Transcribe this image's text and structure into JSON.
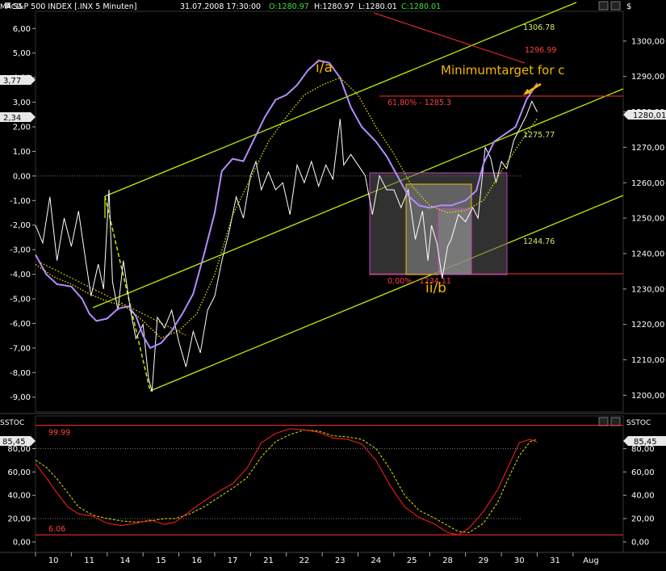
{
  "header": {
    "symbol": "S&P 500 INDEX [.INX  5 Minuten]",
    "datetime": "31.07.2008 17:30:00",
    "open": "O:1280.97",
    "high": "H:1280.97",
    "low": "L:1280.01",
    "close": "C:1280.01"
  },
  "colors": {
    "background": "#000000",
    "price": "#ffffff",
    "macd": "#b48cff",
    "signal": "#e8e000",
    "channel": "#b8f000",
    "target_line": "#ff3030",
    "stoch_k": "#ff2020",
    "stoch_d": "#e8e000",
    "fib_box": "#c040c0",
    "annotation": "#f5b800"
  },
  "chart_data": [
    {
      "type": "line",
      "name": "price-panel",
      "left_axis_label": "MACD",
      "left_ticks": [
        6.0,
        5.0,
        4.0,
        3.0,
        2.0,
        1.0,
        0.0,
        -1.0,
        -2.0,
        -3.0,
        -4.0,
        -5.0,
        -6.0,
        -7.0,
        -8.0,
        -9.0
      ],
      "left_tick_labels": [
        "6,00",
        "5,00",
        "4,00",
        "3,00",
        "2,00",
        "1,00",
        "0,00",
        "-1,00",
        "-2,00",
        "-3,00",
        "-4,00",
        "-5,00",
        "-6,00",
        "-7,00",
        "-8,00",
        "-9,00"
      ],
      "right_ticks": [
        1300,
        1290,
        1280,
        1270,
        1260,
        1250,
        1240,
        1230,
        1220,
        1210,
        1200
      ],
      "right_tick_labels": [
        "1300,00",
        "1290,00",
        "1280,00",
        "1270,00",
        "1260,00",
        "1250,00",
        "1240,00",
        "1230,00",
        "1220,00",
        "1210,00",
        "1200,00"
      ],
      "price_ylim": [
        1195.3,
        1308.4
      ],
      "macd_ylim": [
        -9.6,
        6.7
      ],
      "x_ticks": [
        "10",
        "11",
        "14",
        "15",
        "16",
        "17",
        "21",
        "22",
        "23",
        "24",
        "25",
        "28",
        "29",
        "30",
        "31",
        "Aug"
      ],
      "x_range": [
        0,
        16.4
      ],
      "current_macd_label": "3,77",
      "current_signal_label": "2,34",
      "current_price_label": "1280,01",
      "price_series": [
        [
          0,
          1248
        ],
        [
          0.2,
          1243
        ],
        [
          0.4,
          1256
        ],
        [
          0.6,
          1238
        ],
        [
          0.8,
          1250
        ],
        [
          1.0,
          1242
        ],
        [
          1.2,
          1252
        ],
        [
          1.4,
          1238
        ],
        [
          1.55,
          1228
        ],
        [
          1.75,
          1237
        ],
        [
          1.9,
          1230
        ],
        [
          2.05,
          1258
        ],
        [
          2.15,
          1232
        ],
        [
          2.3,
          1224
        ],
        [
          2.45,
          1238
        ],
        [
          2.65,
          1224
        ],
        [
          2.8,
          1216
        ],
        [
          3.0,
          1220
        ],
        [
          3.15,
          1205
        ],
        [
          3.25,
          1201
        ],
        [
          3.4,
          1222
        ],
        [
          3.6,
          1219
        ],
        [
          3.8,
          1224
        ],
        [
          4.0,
          1215
        ],
        [
          4.2,
          1208
        ],
        [
          4.4,
          1218
        ],
        [
          4.6,
          1212
        ],
        [
          4.8,
          1224
        ],
        [
          5.0,
          1228
        ],
        [
          5.2,
          1238
        ],
        [
          5.4,
          1246
        ],
        [
          5.6,
          1256
        ],
        [
          5.8,
          1250
        ],
        [
          6.0,
          1262
        ],
        [
          6.15,
          1266
        ],
        [
          6.3,
          1258
        ],
        [
          6.5,
          1263
        ],
        [
          6.7,
          1258
        ],
        [
          6.9,
          1260
        ],
        [
          7.1,
          1251
        ],
        [
          7.3,
          1265
        ],
        [
          7.5,
          1260
        ],
        [
          7.7,
          1266
        ],
        [
          7.9,
          1259
        ],
        [
          8.1,
          1265
        ],
        [
          8.3,
          1261
        ],
        [
          8.5,
          1278
        ],
        [
          8.6,
          1265
        ],
        [
          8.8,
          1268
        ],
        [
          9.0,
          1265
        ],
        [
          9.2,
          1262
        ],
        [
          9.4,
          1251
        ],
        [
          9.6,
          1262
        ],
        [
          9.8,
          1258
        ],
        [
          10.0,
          1258
        ],
        [
          10.2,
          1253
        ],
        [
          10.4,
          1258
        ],
        [
          10.6,
          1244
        ],
        [
          10.8,
          1252
        ],
        [
          10.95,
          1238
        ],
        [
          11.05,
          1248
        ],
        [
          11.2,
          1243
        ],
        [
          11.35,
          1233
        ],
        [
          11.5,
          1242
        ],
        [
          11.6,
          1244
        ],
        [
          11.8,
          1251
        ],
        [
          12.0,
          1249
        ],
        [
          12.2,
          1253
        ],
        [
          12.35,
          1250
        ],
        [
          12.55,
          1270
        ],
        [
          12.7,
          1267
        ],
        [
          12.85,
          1260
        ],
        [
          13.0,
          1266
        ],
        [
          13.15,
          1264
        ],
        [
          13.35,
          1272
        ],
        [
          13.55,
          1276
        ],
        [
          13.7,
          1279
        ],
        [
          13.85,
          1283
        ],
        [
          14.0,
          1280
        ]
      ],
      "macd_series": [
        [
          0,
          -3.2
        ],
        [
          0.3,
          -4.0
        ],
        [
          0.6,
          -4.4
        ],
        [
          1.0,
          -4.5
        ],
        [
          1.3,
          -5.0
        ],
        [
          1.5,
          -5.6
        ],
        [
          1.7,
          -5.9
        ],
        [
          2.0,
          -5.8
        ],
        [
          2.3,
          -5.4
        ],
        [
          2.6,
          -5.3
        ],
        [
          2.8,
          -5.7
        ],
        [
          3.0,
          -6.5
        ],
        [
          3.2,
          -7.0
        ],
        [
          3.5,
          -6.8
        ],
        [
          3.8,
          -6.3
        ],
        [
          4.1,
          -5.6
        ],
        [
          4.4,
          -4.8
        ],
        [
          4.7,
          -3.2
        ],
        [
          5.0,
          -1.5
        ],
        [
          5.2,
          0.2
        ],
        [
          5.5,
          0.7
        ],
        [
          5.8,
          0.6
        ],
        [
          6.1,
          1.5
        ],
        [
          6.4,
          2.4
        ],
        [
          6.7,
          3.1
        ],
        [
          7.0,
          3.3
        ],
        [
          7.3,
          3.7
        ],
        [
          7.6,
          4.3
        ],
        [
          7.9,
          4.7
        ],
        [
          8.2,
          4.6
        ],
        [
          8.5,
          4.0
        ],
        [
          8.8,
          2.8
        ],
        [
          9.1,
          2.0
        ],
        [
          9.5,
          1.4
        ],
        [
          9.8,
          0.8
        ],
        [
          10.1,
          0.0
        ],
        [
          10.4,
          -0.8
        ],
        [
          10.7,
          -1.2
        ],
        [
          11.0,
          -1.3
        ],
        [
          11.3,
          -1.2
        ],
        [
          11.6,
          -1.2
        ],
        [
          12.0,
          -1.0
        ],
        [
          12.3,
          -0.6
        ],
        [
          12.5,
          0.5
        ],
        [
          12.8,
          1.4
        ],
        [
          13.1,
          1.7
        ],
        [
          13.4,
          2.0
        ],
        [
          13.7,
          3.1
        ],
        [
          14.0,
          3.77
        ]
      ],
      "signal_series": [
        [
          0,
          -3.6
        ],
        [
          0.5,
          -4.1
        ],
        [
          1.0,
          -4.4
        ],
        [
          1.5,
          -4.8
        ],
        [
          2.0,
          -5.1
        ],
        [
          2.5,
          -5.3
        ],
        [
          3.0,
          -5.9
        ],
        [
          3.5,
          -6.6
        ],
        [
          4.0,
          -6.3
        ],
        [
          4.5,
          -5.6
        ],
        [
          5.0,
          -4.0
        ],
        [
          5.5,
          -1.6
        ],
        [
          6.0,
          -0.1
        ],
        [
          6.5,
          1.4
        ],
        [
          7.0,
          2.4
        ],
        [
          7.5,
          3.3
        ],
        [
          8.0,
          3.7
        ],
        [
          8.5,
          4.0
        ],
        [
          9.0,
          3.3
        ],
        [
          9.5,
          2.0
        ],
        [
          10.0,
          0.9
        ],
        [
          10.5,
          -0.4
        ],
        [
          11.0,
          -1.2
        ],
        [
          11.5,
          -1.5
        ],
        [
          12.0,
          -1.4
        ],
        [
          12.5,
          -1.0
        ],
        [
          13.0,
          0.2
        ],
        [
          13.5,
          1.3
        ],
        [
          14.0,
          2.34
        ]
      ],
      "annotations": {
        "wave_1_label": "i/a",
        "wave_2_label": "ii/b",
        "target_label": "Minimumtarget for c",
        "fib_618_label": "61,80% - 1285.3",
        "fib_0_label": "0,00% - 1234.11",
        "level_1306": "1306.78",
        "level_1296": "1296.99",
        "level_1275": "1275.77",
        "level_1244": "1244.76"
      },
      "xlabel": "",
      "ylabel": ""
    },
    {
      "type": "line",
      "name": "stochastic-panel",
      "left_axis_label": "SSTOC",
      "right_axis_label": "SSTOC",
      "ylim": [
        -9,
        108
      ],
      "y_ticks": [
        80,
        60,
        40,
        20,
        0
      ],
      "y_tick_labels": [
        "80,00",
        "60,00",
        "40,00",
        "20,00",
        "0,00"
      ],
      "upper_band_label": "99.99",
      "lower_band_label": "6.06",
      "current_label": "85,45",
      "k_series": [
        [
          0,
          67
        ],
        [
          0.3,
          55
        ],
        [
          0.6,
          42
        ],
        [
          0.9,
          30
        ],
        [
          1.2,
          24
        ],
        [
          1.6,
          22
        ],
        [
          2.0,
          16
        ],
        [
          2.4,
          14
        ],
        [
          2.8,
          16
        ],
        [
          3.2,
          19
        ],
        [
          3.6,
          15
        ],
        [
          3.9,
          17
        ],
        [
          4.3,
          26
        ],
        [
          4.7,
          35
        ],
        [
          5.1,
          43
        ],
        [
          5.5,
          50
        ],
        [
          5.9,
          63
        ],
        [
          6.3,
          85
        ],
        [
          6.7,
          93
        ],
        [
          7.1,
          97
        ],
        [
          7.5,
          96
        ],
        [
          7.9,
          94
        ],
        [
          8.3,
          89
        ],
        [
          8.7,
          88
        ],
        [
          9.1,
          84
        ],
        [
          9.5,
          70
        ],
        [
          9.9,
          48
        ],
        [
          10.3,
          30
        ],
        [
          10.7,
          21
        ],
        [
          11.1,
          16
        ],
        [
          11.5,
          8
        ],
        [
          11.8,
          6
        ],
        [
          12.1,
          12
        ],
        [
          12.5,
          26
        ],
        [
          12.9,
          45
        ],
        [
          13.2,
          65
        ],
        [
          13.5,
          85
        ],
        [
          13.8,
          88
        ],
        [
          14.0,
          85.45
        ]
      ],
      "d_series": [
        [
          0,
          70
        ],
        [
          0.3,
          64
        ],
        [
          0.6,
          54
        ],
        [
          0.9,
          42
        ],
        [
          1.2,
          30
        ],
        [
          1.6,
          23
        ],
        [
          2.0,
          20
        ],
        [
          2.4,
          18
        ],
        [
          2.8,
          17
        ],
        [
          3.2,
          18
        ],
        [
          3.6,
          20
        ],
        [
          3.9,
          20
        ],
        [
          4.3,
          24
        ],
        [
          4.7,
          30
        ],
        [
          5.1,
          38
        ],
        [
          5.5,
          46
        ],
        [
          5.9,
          55
        ],
        [
          6.3,
          73
        ],
        [
          6.7,
          86
        ],
        [
          7.1,
          92
        ],
        [
          7.5,
          96
        ],
        [
          7.9,
          95
        ],
        [
          8.3,
          91
        ],
        [
          8.7,
          90
        ],
        [
          9.1,
          88
        ],
        [
          9.5,
          80
        ],
        [
          9.9,
          62
        ],
        [
          10.3,
          40
        ],
        [
          10.7,
          27
        ],
        [
          11.1,
          21
        ],
        [
          11.5,
          14
        ],
        [
          11.8,
          9
        ],
        [
          12.1,
          8
        ],
        [
          12.5,
          16
        ],
        [
          12.9,
          34
        ],
        [
          13.2,
          55
        ],
        [
          13.5,
          74
        ],
        [
          13.8,
          86
        ],
        [
          14.0,
          88
        ]
      ]
    }
  ]
}
